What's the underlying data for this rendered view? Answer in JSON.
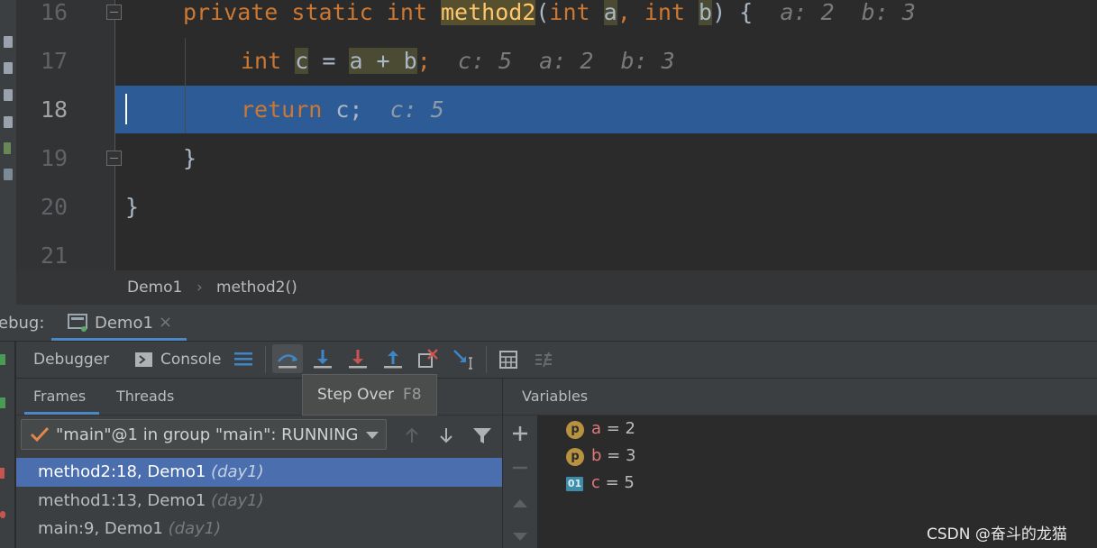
{
  "editor": {
    "line_numbers": [
      "16",
      "17",
      "18",
      "19",
      "20",
      "21"
    ],
    "current_line": "18",
    "line16": {
      "kw1": "private static int ",
      "fn": "method2",
      "p1": "(",
      "kw2": "int ",
      "v1": "a",
      ",": ", ",
      "kw3": "int ",
      "v2": "b",
      "p2": ") {",
      "hint": "a: 2  b: 3"
    },
    "line17": {
      "kw": "int ",
      "v": "c",
      "op": " = ",
      "a": "a + b",
      "semi": ";",
      "hint": "c: 5  a: 2  b: 3"
    },
    "line18": {
      "kw": "return ",
      "v": "c;",
      "hint": "c: 5"
    },
    "line19": {
      "brace": "}"
    },
    "line20": {
      "brace": "}"
    }
  },
  "breadcrumb": {
    "class": "Demo1",
    "sep": "›",
    "method": "method2()"
  },
  "debug_header": {
    "label": "ebug:",
    "tab": "Demo1",
    "close": "×"
  },
  "toolbar": {
    "debugger_tab": "Debugger",
    "console_tab": "Console"
  },
  "tooltip": {
    "action": "Step Over",
    "shortcut": "F8"
  },
  "frames": {
    "tabs": [
      "Frames",
      "Threads"
    ],
    "thread_select": "\"main\"@1 in group \"main\": RUNNING",
    "rows": [
      {
        "name": "method2:18, Demo1 ",
        "module": "(day1)"
      },
      {
        "name": "method1:13, Demo1 ",
        "module": "(day1)"
      },
      {
        "name": "main:9, Demo1 ",
        "module": "(day1)"
      }
    ]
  },
  "variables": {
    "title": "Variables",
    "items": [
      {
        "badge": "p",
        "name": "a",
        "value": " = 2"
      },
      {
        "badge": "p",
        "name": "b",
        "value": " = 3"
      },
      {
        "badge": "01",
        "name": "c",
        "value": " = 5"
      }
    ]
  },
  "watermark": "CSDN @奋斗的龙猫",
  "colors": {
    "selection": "#2d5b95",
    "frame_selected": "#4b6eaf",
    "keyword": "#cc7832",
    "function": "#ffc66d"
  }
}
